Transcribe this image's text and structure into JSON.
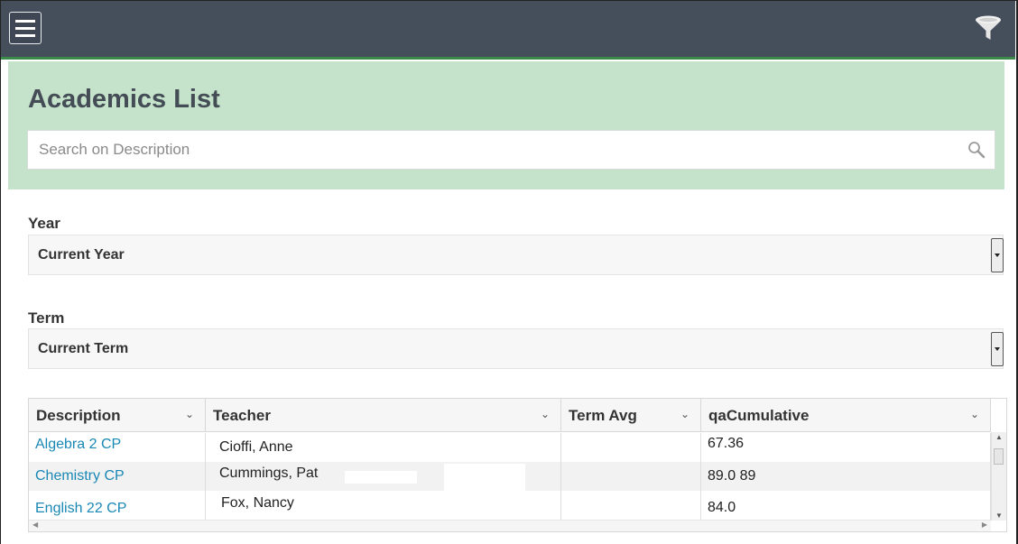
{
  "toolbar": {
    "menu_icon": "hamburger-menu-icon",
    "filter_icon": "funnel-filter-icon"
  },
  "header": {
    "title": "Academics List",
    "search_placeholder": "Search on Description",
    "search_icon": "magnifier-icon"
  },
  "filters": {
    "year": {
      "label": "Year",
      "value": "Current Year"
    },
    "term": {
      "label": "Term",
      "value": "Current Term"
    }
  },
  "grid": {
    "columns": [
      "Description",
      "Teacher",
      "Term Avg",
      "qaCumulative"
    ],
    "rows": [
      {
        "description": "Algebra 2 CP",
        "teacher": "Cioffi, Anne",
        "term_avg": "",
        "cumulative": "67.36"
      },
      {
        "description": "Chemistry CP",
        "teacher": "Cummings, Pat",
        "term_avg": "",
        "cumulative": "89.0 89"
      },
      {
        "description": "English 22 CP",
        "teacher": "Fox, Nancy",
        "term_avg": "",
        "cumulative": "84.0"
      }
    ]
  },
  "colors": {
    "topbar": "#454f5c",
    "header_bg": "#c5e2cb",
    "accent_line": "#3c8a4a",
    "link": "#1a88b5"
  }
}
